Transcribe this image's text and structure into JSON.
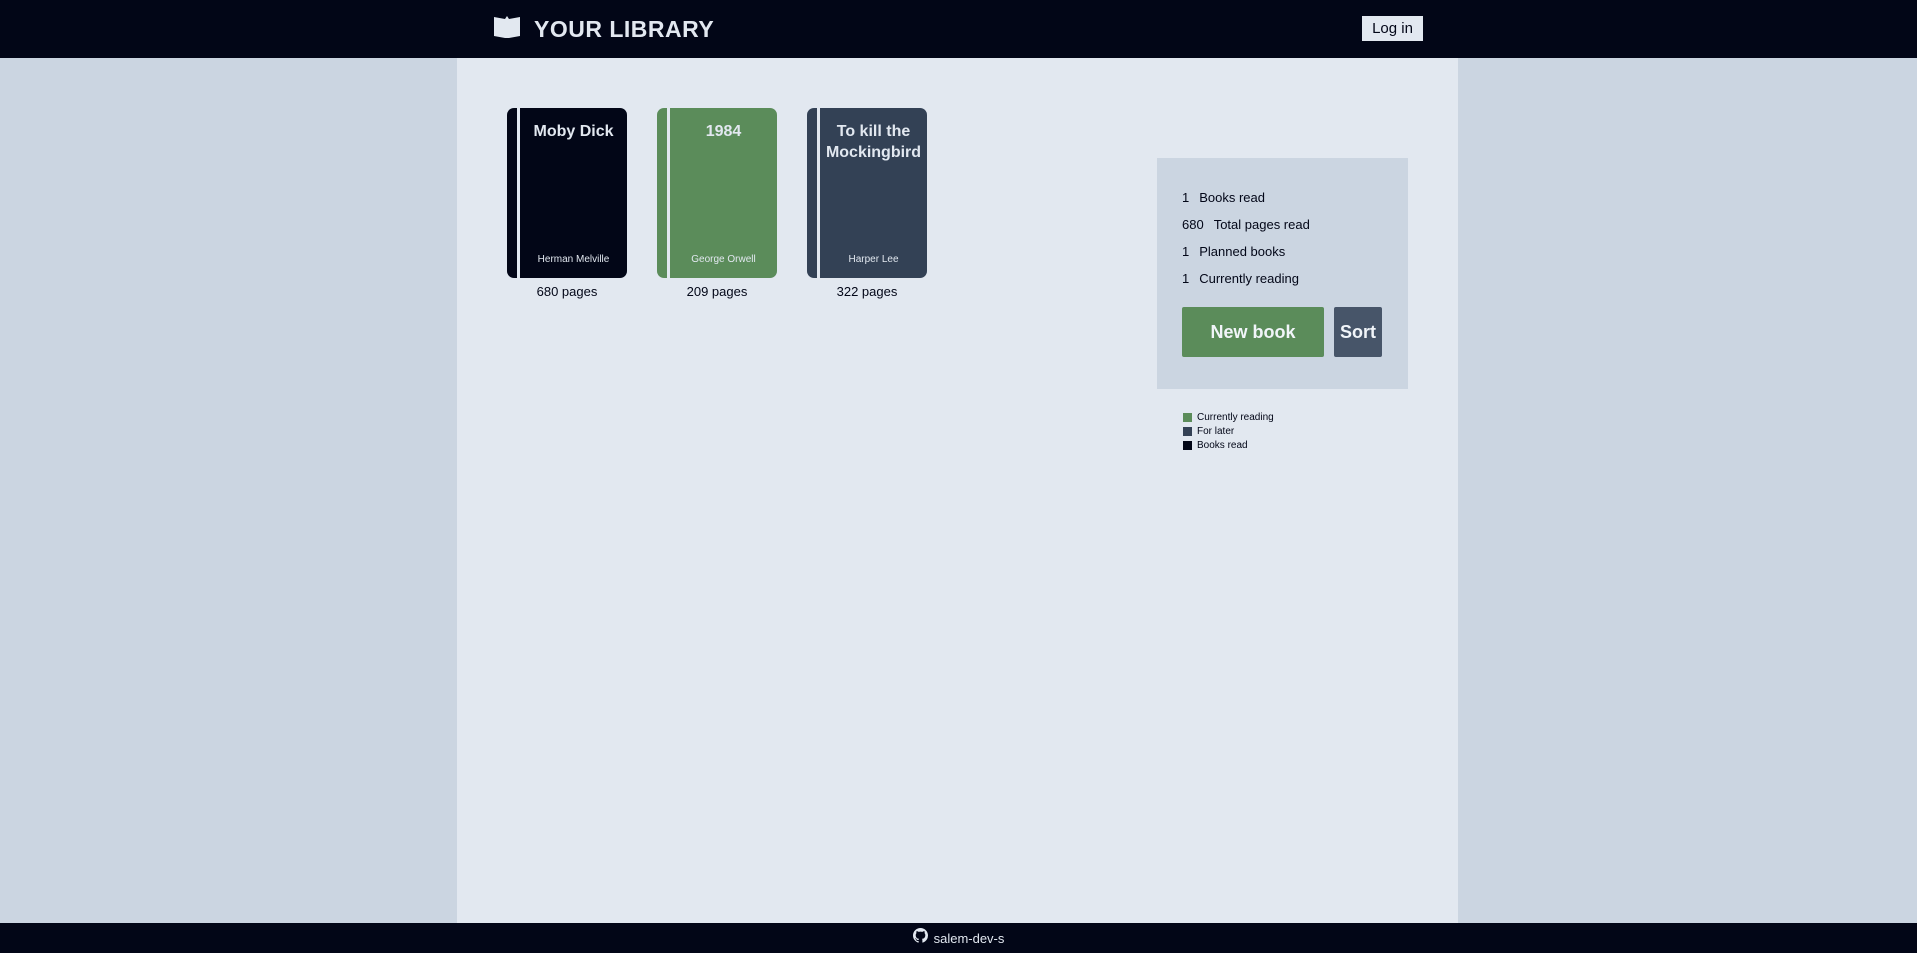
{
  "header": {
    "title": "YOUR LIBRARY",
    "login_label": "Log in",
    "icon": "book-open-icon"
  },
  "books": [
    {
      "title": "Moby Dick",
      "author": "Herman Melville",
      "pages": "680 pages",
      "status": "Books read",
      "color": "#020617"
    },
    {
      "title": "1984",
      "author": "George Orwell",
      "pages": "209 pages",
      "status": "Currently reading",
      "color": "#5b8c5a"
    },
    {
      "title": "To kill the Mockingbird",
      "author": "Harper Lee",
      "pages": "322 pages",
      "status": "For later",
      "color": "#334155"
    }
  ],
  "stats": [
    {
      "value": "1",
      "label": "Books read"
    },
    {
      "value": "680",
      "label": "Total pages read"
    },
    {
      "value": "1",
      "label": "Planned books"
    },
    {
      "value": "1",
      "label": "Currently reading"
    }
  ],
  "actions": {
    "new_book_label": "New book",
    "sort_label": "Sort"
  },
  "legend": [
    {
      "label": "Currently reading",
      "color": "#5b8c5a"
    },
    {
      "label": "For later",
      "color": "#334155"
    },
    {
      "label": "Books read",
      "color": "#020617"
    }
  ],
  "footer": {
    "text": "salem-dev-s",
    "icon": "github-icon"
  },
  "colors": {
    "dark": "#020617",
    "green": "#5b8c5a",
    "slate": "#334155",
    "light": "#e2e8f0",
    "panel": "#cbd5e1"
  }
}
